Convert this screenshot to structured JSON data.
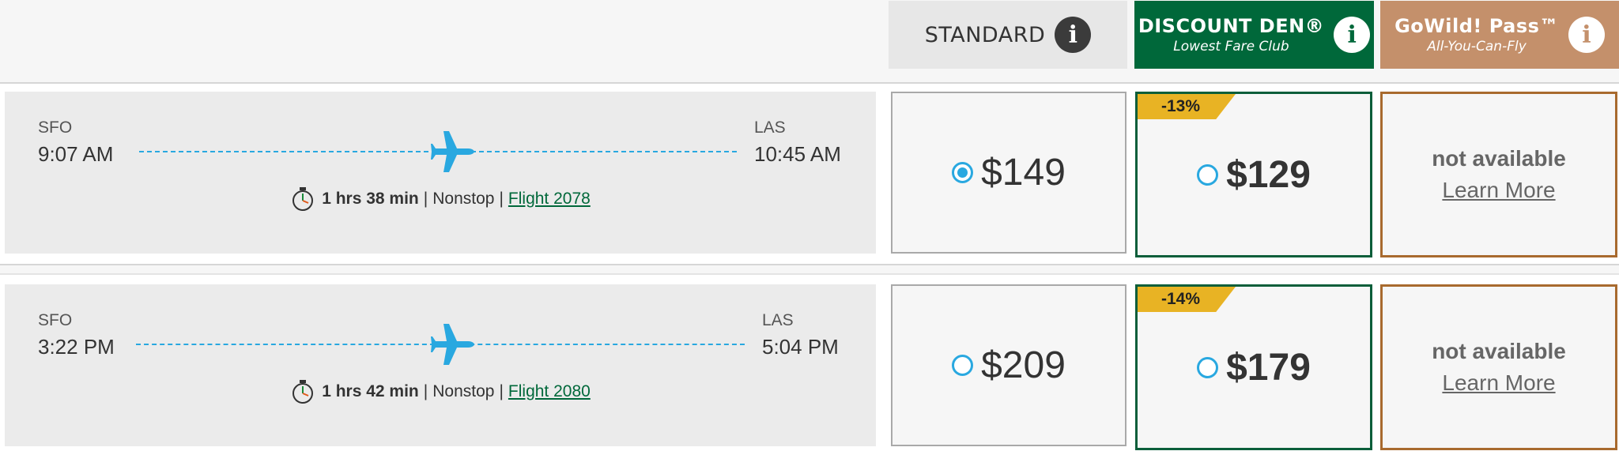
{
  "columns": {
    "standard": {
      "title": "STANDARD",
      "icon": "info-icon"
    },
    "discount_den": {
      "title": "DISCOUNT DEN®",
      "subtitle": "Lowest Fare Club",
      "icon": "info-icon",
      "color": "#00683a"
    },
    "gowild": {
      "title": "GoWild! Pass™",
      "subtitle": "All-You-Can-Fly",
      "icon": "info-icon",
      "color": "#c4906b"
    }
  },
  "flights": [
    {
      "origin": "SFO",
      "depart_time": "9:07 AM",
      "destination": "LAS",
      "arrive_time": "10:45 AM",
      "duration": "1 hrs 38 min",
      "stops": "Nonstop",
      "flight_link": "Flight 2078",
      "standard_price": "$149",
      "standard_selected": true,
      "den_discount": "-13%",
      "den_price": "$129",
      "den_selected": false,
      "gowild_status": "not available",
      "gowild_link": "Learn More"
    },
    {
      "origin": "SFO",
      "depart_time": "3:22 PM",
      "destination": "LAS",
      "arrive_time": "5:04 PM",
      "duration": "1 hrs 42 min",
      "stops": "Nonstop",
      "flight_link": "Flight 2080",
      "standard_price": "$209",
      "standard_selected": false,
      "den_discount": "-14%",
      "den_price": "$179",
      "den_selected": false,
      "gowild_status": "not available",
      "gowild_link": "Learn More"
    }
  ],
  "separator": " | ",
  "accent_color": "#29a8e0"
}
